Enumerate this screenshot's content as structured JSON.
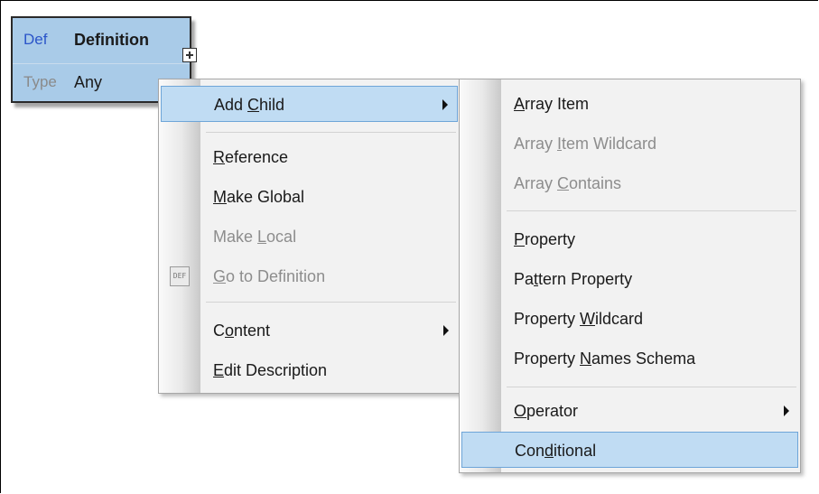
{
  "definition_box": {
    "tag_def": "Def",
    "name": "Definition",
    "tag_type": "Type",
    "type_value": "Any"
  },
  "context_menu": {
    "add_child": {
      "pre": "Add ",
      "u": "C",
      "post": "hild"
    },
    "reference": {
      "pre": "",
      "u": "R",
      "post": "eference"
    },
    "make_global": {
      "pre": "",
      "u": "M",
      "post": "ake Global"
    },
    "make_local": {
      "pre": "Make ",
      "u": "L",
      "post": "ocal"
    },
    "go_to_definition": {
      "pre": "",
      "u": "G",
      "post": "o to Definition"
    },
    "go_to_definition_icon_text": "DEF",
    "content": {
      "pre": "C",
      "u": "o",
      "post": "ntent"
    },
    "edit_description": {
      "pre": "",
      "u": "E",
      "post": "dit Description"
    }
  },
  "submenu": {
    "array_item": {
      "pre": "",
      "u": "A",
      "post": "rray Item"
    },
    "array_item_wildcard": {
      "pre": "Array ",
      "u": "I",
      "post": "tem Wildcard"
    },
    "array_contains": {
      "pre": "Array ",
      "u": "C",
      "post": "ontains"
    },
    "property": {
      "pre": "",
      "u": "P",
      "post": "roperty"
    },
    "pattern_property": {
      "pre": "Pa",
      "u": "t",
      "post": "tern Property"
    },
    "property_wildcard": {
      "pre": "Property ",
      "u": "W",
      "post": "ildcard"
    },
    "property_names_schema": {
      "pre": "Property ",
      "u": "N",
      "post": "ames Schema"
    },
    "operator": {
      "pre": "",
      "u": "O",
      "post": "perator"
    },
    "conditional": {
      "pre": "Con",
      "u": "d",
      "post": "itional"
    }
  },
  "icons": {
    "expander": "plus-box-icon",
    "submenu_arrow": "chevron-right-icon",
    "go_to_definition": "go-to-definition-icon"
  },
  "colors": {
    "definition_box_bg": "#a9cbe8",
    "highlight_bg": "#c0dcf3",
    "def_tag": "#2b55c9"
  }
}
